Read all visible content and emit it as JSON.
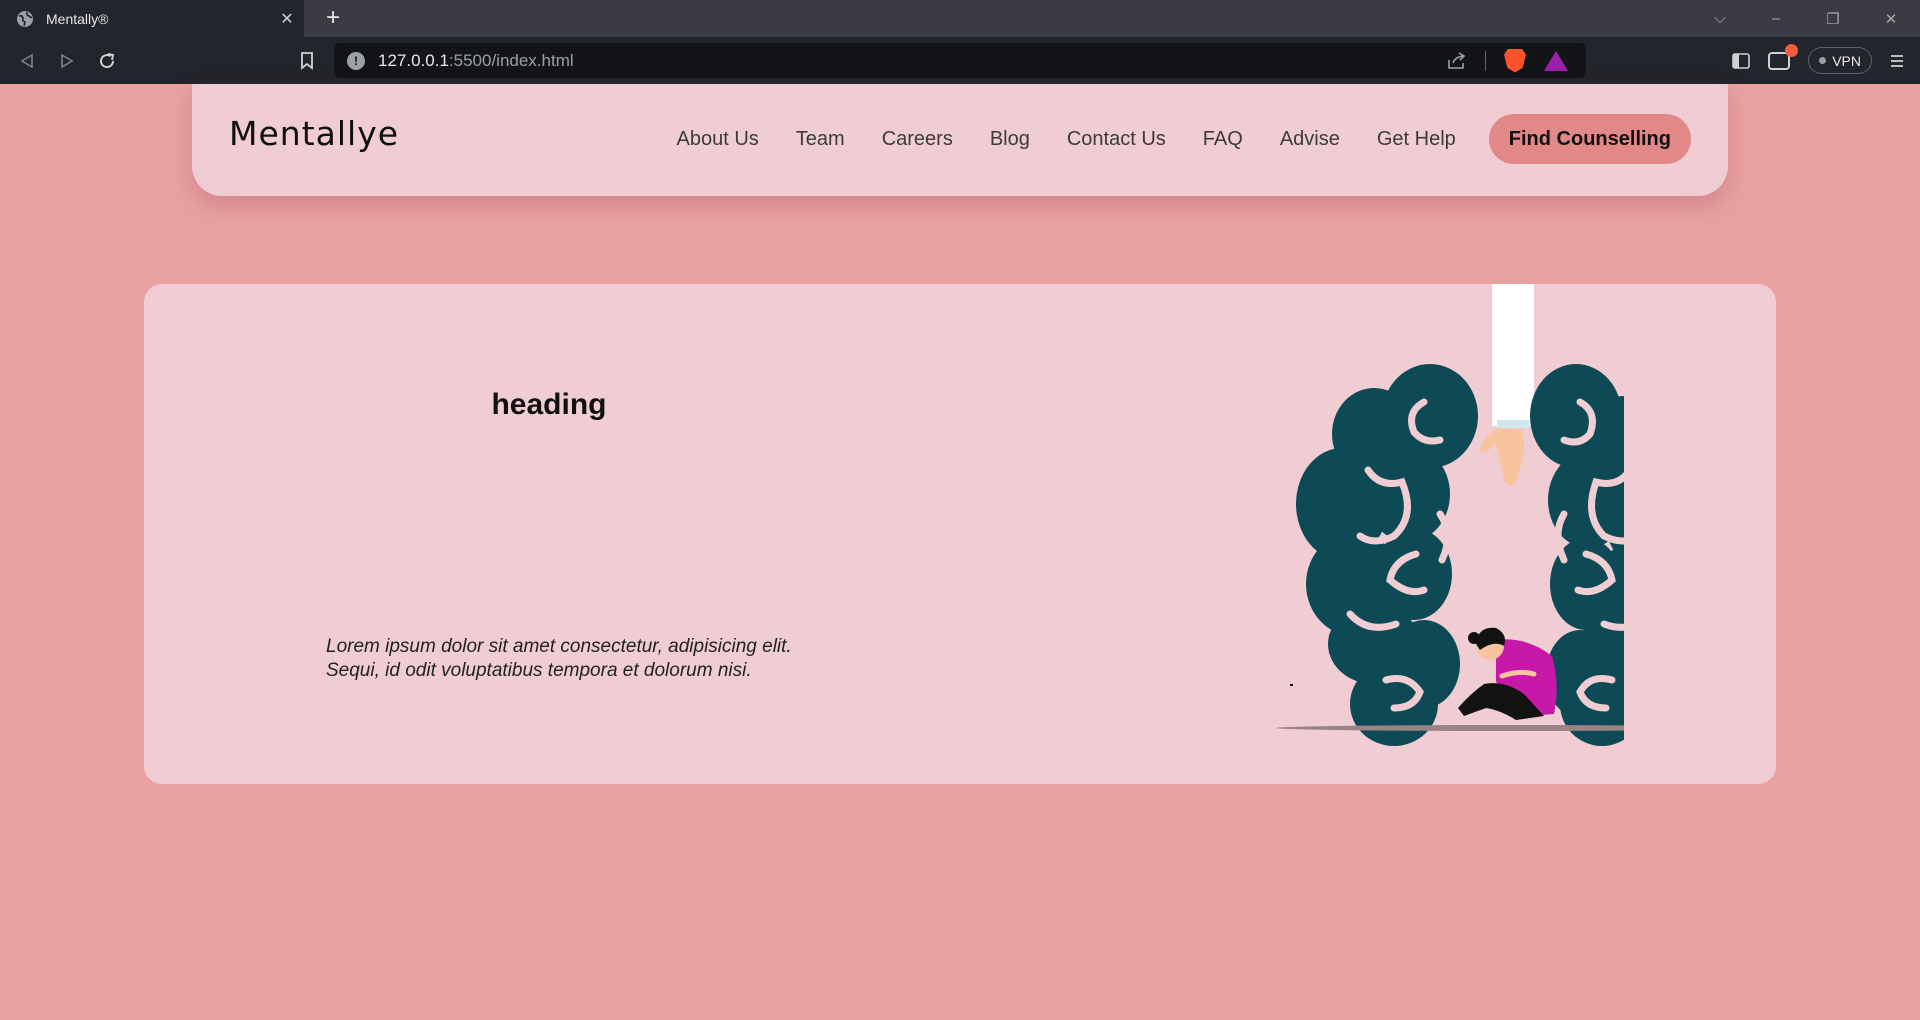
{
  "browser": {
    "tab_title": "Mentally®",
    "tab_close": "✕",
    "new_tab": "+",
    "url_host": "127.0.0.1",
    "url_rest": ":5500/index.html",
    "vpn_label": "VPN",
    "window_controls": [
      "⌵",
      "–",
      "❐",
      "✕"
    ]
  },
  "navbar": {
    "logo": "Mentallye",
    "links": [
      "About Us",
      "Team",
      "Careers",
      "Blog",
      "Contact Us",
      "FAQ",
      "Advise",
      "Get Help"
    ],
    "cta": "Find Counselling"
  },
  "hero": {
    "heading": "heading",
    "text": "Lorem ipsum dolor sit amet consectetur, adipisicing elit. Sequi, id odit voluptatibus tempora et dolorum nisi.",
    "illustration": "brain-hands-illustration"
  },
  "colors": {
    "page_bg": "#e9a1a2",
    "card_bg": "#f0cdd2",
    "cta_bg": "#e38889",
    "brain": "#0e4a55",
    "figure_top": "#c818a8"
  }
}
